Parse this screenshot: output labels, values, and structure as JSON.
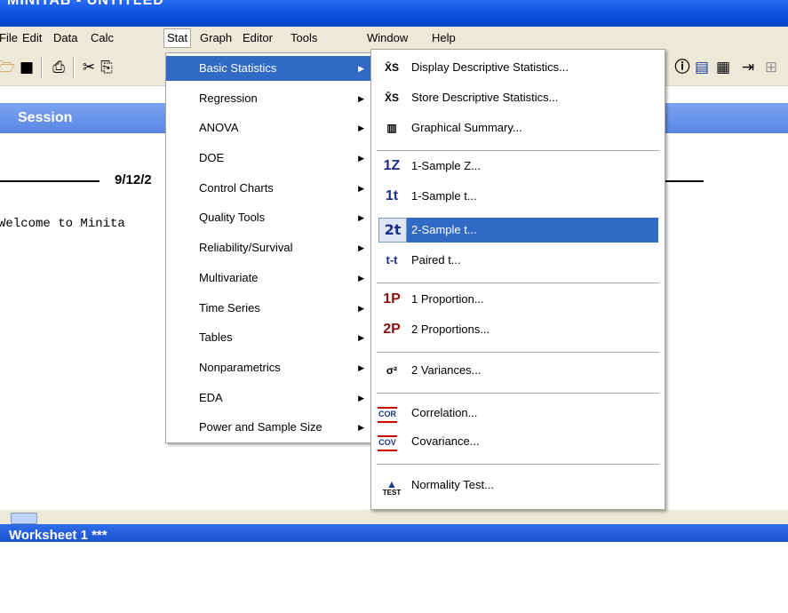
{
  "window": {
    "title": "MINITAB - UNTITLED"
  },
  "menubar": {
    "items": [
      "File",
      "Edit",
      "Data",
      "Calc",
      "Stat",
      "Graph",
      "Editor",
      "Tools",
      "Window",
      "Help"
    ],
    "open": "Stat"
  },
  "toolbar": {
    "icons": [
      "open-icon",
      "save-icon",
      "print-icon",
      "cut-icon",
      "copy-icon",
      "session-icon",
      "info-icon",
      "report-icon",
      "worksheet-icon",
      "project-icon"
    ]
  },
  "session": {
    "title": "Session",
    "date": "9/12/2",
    "welcome": "Welcome to Minita"
  },
  "worksheet": {
    "title": "Worksheet 1 ***"
  },
  "stat_menu": {
    "items": [
      "Basic Statistics",
      "Regression",
      "ANOVA",
      "DOE",
      "Control Charts",
      "Quality Tools",
      "Reliability/Survival",
      "Multivariate",
      "Time Series",
      "Tables",
      "Nonparametrics",
      "EDA",
      "Power and Sample Size"
    ]
  },
  "basic_stats_menu": {
    "items": [
      {
        "label": "Display Descriptive Statistics...",
        "icon": "X̄S"
      },
      {
        "label": "Store Descriptive Statistics...",
        "icon": "X̄S"
      },
      {
        "label": "Graphical Summary...",
        "icon": "▥"
      },
      {
        "label": "1-Sample Z...",
        "icon": "1Z"
      },
      {
        "label": "1-Sample t...",
        "icon": "1t"
      },
      {
        "label": "2-Sample t...",
        "icon": "2t"
      },
      {
        "label": "Paired t...",
        "icon": "t-t"
      },
      {
        "label": "1 Proportion...",
        "icon": "1P"
      },
      {
        "label": "2 Proportions...",
        "icon": "2P"
      },
      {
        "label": "2 Variances...",
        "icon": "σ²"
      },
      {
        "label": "Correlation...",
        "icon": "COR"
      },
      {
        "label": "Covariance...",
        "icon": "COV"
      },
      {
        "label": "Normality Test...",
        "icon": "TEST"
      }
    ],
    "highlighted": "2-Sample t..."
  },
  "colors": {
    "highlight": "#316ac5",
    "menu_bg": "#ece9d8",
    "titlebar": "#0b4fe0"
  }
}
